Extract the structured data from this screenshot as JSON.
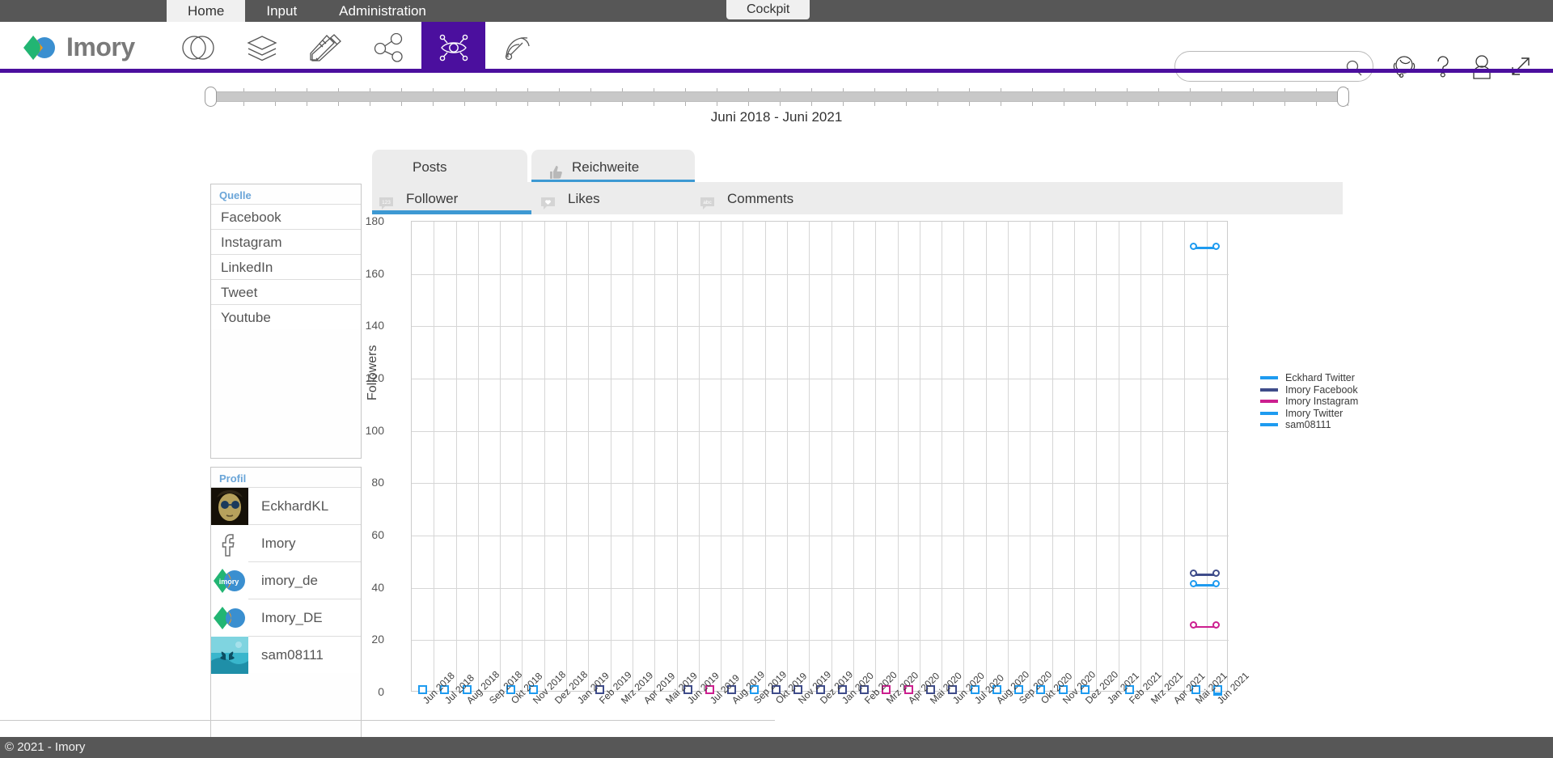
{
  "topbar": {
    "items": [
      {
        "label": "Home",
        "active": true
      },
      {
        "label": "Input",
        "active": false
      },
      {
        "label": "Administration",
        "active": false
      }
    ],
    "cockpit_label": "Cockpit"
  },
  "brand": {
    "name": "Imory"
  },
  "navicons": [
    {
      "name": "venn-circles-icon",
      "active": false
    },
    {
      "name": "layers-icon",
      "active": false
    },
    {
      "name": "pencil-ruler-icon",
      "active": false
    },
    {
      "name": "share-network-icon",
      "active": false
    },
    {
      "name": "eye-network-icon",
      "active": true
    },
    {
      "name": "satellite-dish-icon",
      "active": false
    }
  ],
  "header_actions": [
    {
      "name": "headset-support-icon"
    },
    {
      "name": "question-help-icon"
    },
    {
      "name": "user-account-icon"
    },
    {
      "name": "expand-fullscreen-icon"
    }
  ],
  "search": {
    "value": "",
    "placeholder": ""
  },
  "timeline": {
    "range_label": "Juni 2018 - Juni 2021",
    "start": "Juni 2018",
    "end": "Juni 2021"
  },
  "panels": {
    "quelle": {
      "title": "Quelle",
      "items": [
        "Facebook",
        "Instagram",
        "LinkedIn",
        "Tweet",
        "Youtube"
      ]
    },
    "profil": {
      "title": "Profil",
      "items": [
        {
          "name": "EckhardKL",
          "avatar": "photo-avatar"
        },
        {
          "name": "Imory",
          "avatar": "facebook-logo"
        },
        {
          "name": "imory_de",
          "avatar": "imory-badge-logo"
        },
        {
          "name": "Imory_DE",
          "avatar": "imory-circles-logo"
        },
        {
          "name": "sam08111",
          "avatar": "butterfly-photo"
        }
      ]
    }
  },
  "tabs_primary": [
    {
      "label": "Posts",
      "icon": "",
      "active": false
    },
    {
      "label": "Reichweite",
      "icon": "thumbs-up-icon",
      "active": true
    }
  ],
  "tabs_secondary": [
    {
      "label": "Follower",
      "icon": "123-bubble-icon",
      "active": true
    },
    {
      "label": "Likes",
      "icon": "heart-bubble-icon",
      "active": false
    },
    {
      "label": "Comments",
      "icon": "abc-bubble-icon",
      "active": false
    }
  ],
  "colors": {
    "accent_purple": "#4b0f9e",
    "tab_blue": "#3d99d3",
    "light_blue": "#1e9bf0",
    "dark_blue": "#3f4c8a",
    "magenta": "#cc1f8f",
    "panel_title_blue": "#6aa5d8"
  },
  "chart_data": {
    "type": "line",
    "title": "",
    "xlabel": "",
    "ylabel": "Followers",
    "ylim": [
      0,
      180
    ],
    "ytick_step": 20,
    "yticks": [
      0,
      20,
      40,
      60,
      80,
      100,
      120,
      140,
      160,
      180
    ],
    "grid": true,
    "legend_position": "right",
    "categories": [
      "Jun 2018",
      "Jul 2018",
      "Aug 2018",
      "Sep 2018",
      "Okt 2018",
      "Nov 2018",
      "Dez 2018",
      "Jan 2019",
      "Feb 2019",
      "Mrz 2019",
      "Apr 2019",
      "Mai 2019",
      "Jun 2019",
      "Jul 2019",
      "Aug 2019",
      "Sep 2019",
      "Okt 2019",
      "Nov 2019",
      "Dez 2019",
      "Jan 2020",
      "Feb 2020",
      "Mrz 2020",
      "Apr 2020",
      "Mai 2020",
      "Jun 2020",
      "Jul 2020",
      "Aug 2020",
      "Sep 2020",
      "Okt 2020",
      "Nov 2020",
      "Dez 2020",
      "Jan 2021",
      "Feb 2021",
      "Mrz 2021",
      "Apr 2021",
      "Mai 2021",
      "Jun 2021"
    ],
    "series": [
      {
        "name": "Eckhard Twitter",
        "color": "#1e9bf0",
        "points": [
          {
            "x": "Mai 2021",
            "y": 170
          },
          {
            "x": "Jun 2021",
            "y": 170
          }
        ]
      },
      {
        "name": "Imory Facebook",
        "color": "#3f4c8a",
        "points": [
          {
            "x": "Mai 2021",
            "y": 45
          },
          {
            "x": "Jun 2021",
            "y": 45
          }
        ]
      },
      {
        "name": "Imory Instagram",
        "color": "#cc1f8f",
        "points": [
          {
            "x": "Mai 2021",
            "y": 25
          },
          {
            "x": "Jun 2021",
            "y": 25
          }
        ]
      },
      {
        "name": "Imory Twitter",
        "color": "#1e9bf0",
        "points": [
          {
            "x": "Mai 2021",
            "y": 41
          },
          {
            "x": "Jun 2021",
            "y": 41
          }
        ]
      },
      {
        "name": "sam08111",
        "color": "#1e9bf0",
        "points": []
      }
    ],
    "zero_markers": [
      {
        "x": "Jun 2018",
        "color": "#1e9bf0"
      },
      {
        "x": "Jul 2018",
        "color": "#1e9bf0"
      },
      {
        "x": "Aug 2018",
        "color": "#1e9bf0"
      },
      {
        "x": "Okt 2018",
        "color": "#1e9bf0"
      },
      {
        "x": "Nov 2018",
        "color": "#1e9bf0"
      },
      {
        "x": "Feb 2019",
        "color": "#3f4c8a"
      },
      {
        "x": "Jun 2019",
        "color": "#3f4c8a"
      },
      {
        "x": "Jul 2019",
        "color": "#cc1f8f"
      },
      {
        "x": "Aug 2019",
        "color": "#3f4c8a"
      },
      {
        "x": "Sep 2019",
        "color": "#1e9bf0"
      },
      {
        "x": "Okt 2019",
        "color": "#3f4c8a"
      },
      {
        "x": "Nov 2019",
        "color": "#3f4c8a"
      },
      {
        "x": "Dez 2019",
        "color": "#3f4c8a"
      },
      {
        "x": "Jan 2020",
        "color": "#3f4c8a"
      },
      {
        "x": "Feb 2020",
        "color": "#3f4c8a"
      },
      {
        "x": "Mrz 2020",
        "color": "#cc1f8f"
      },
      {
        "x": "Apr 2020",
        "color": "#cc1f8f"
      },
      {
        "x": "Mai 2020",
        "color": "#3f4c8a"
      },
      {
        "x": "Jun 2020",
        "color": "#3f4c8a"
      },
      {
        "x": "Jul 2020",
        "color": "#1e9bf0"
      },
      {
        "x": "Aug 2020",
        "color": "#1e9bf0"
      },
      {
        "x": "Sep 2020",
        "color": "#1e9bf0"
      },
      {
        "x": "Okt 2020",
        "color": "#1e9bf0"
      },
      {
        "x": "Nov 2020",
        "color": "#1e9bf0"
      },
      {
        "x": "Dez 2020",
        "color": "#1e9bf0"
      },
      {
        "x": "Feb 2021",
        "color": "#1e9bf0"
      },
      {
        "x": "Mai 2021",
        "color": "#1e9bf0"
      },
      {
        "x": "Jun 2021",
        "color": "#1e9bf0",
        "shape": "bookmark"
      }
    ]
  },
  "footer": {
    "copyright": "© 2021 - Imory"
  }
}
